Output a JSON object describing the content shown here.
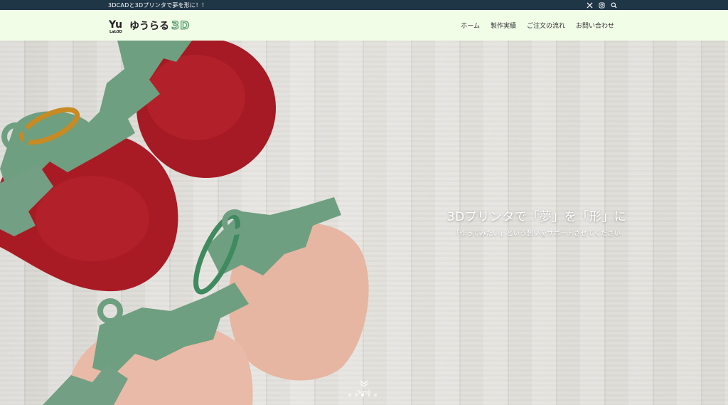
{
  "topbar": {
    "tagline": "3DCADと3Dプリンタで夢を形に！！",
    "icons": [
      "x-icon",
      "instagram-icon",
      "search-icon"
    ]
  },
  "header": {
    "logo_mark_text": "Yu",
    "logo_mark_sub": "Lab3D",
    "logo_text": "ゆうらる",
    "logo_3d": "3D",
    "nav": [
      {
        "label": "ホーム"
      },
      {
        "label": "製作実績"
      },
      {
        "label": "ご注文の流れ"
      },
      {
        "label": "お問い合わせ"
      }
    ]
  },
  "hero": {
    "title": "3Dプリンタで「夢」を「形」に",
    "subtitle": "「作ってみたい」という想いをサポートさせてください",
    "scroll_label": "Scroll",
    "slides_count": 5,
    "active_slide": 3
  },
  "colors": {
    "topbar_bg": "#1f3647",
    "header_bg": "#f2fde8",
    "strawberry_red": "#b21d26",
    "strawberry_pink": "#e8b8a6",
    "leaf_green": "#6e9f80"
  }
}
